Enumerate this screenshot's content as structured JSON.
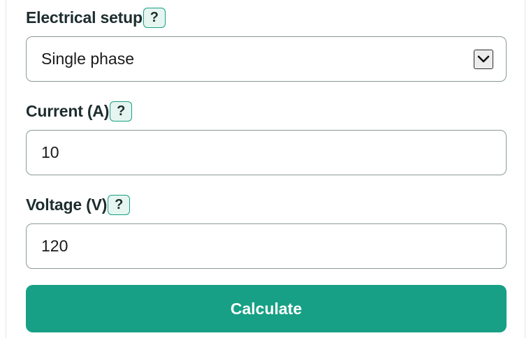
{
  "form": {
    "electrical": {
      "label": "Electrical setup",
      "help": "?",
      "selected": "Single phase"
    },
    "current": {
      "label": "Current (A)",
      "help": "?",
      "value": "10"
    },
    "voltage": {
      "label": "Voltage (V)",
      "help": "?",
      "value": "120"
    },
    "calculate_label": "Calculate"
  },
  "icons": {
    "dropdown": "chevron-down-icon"
  },
  "colors": {
    "accent": "#17a085",
    "help_bg": "#e7f5f1",
    "border": "#8a9a98"
  }
}
